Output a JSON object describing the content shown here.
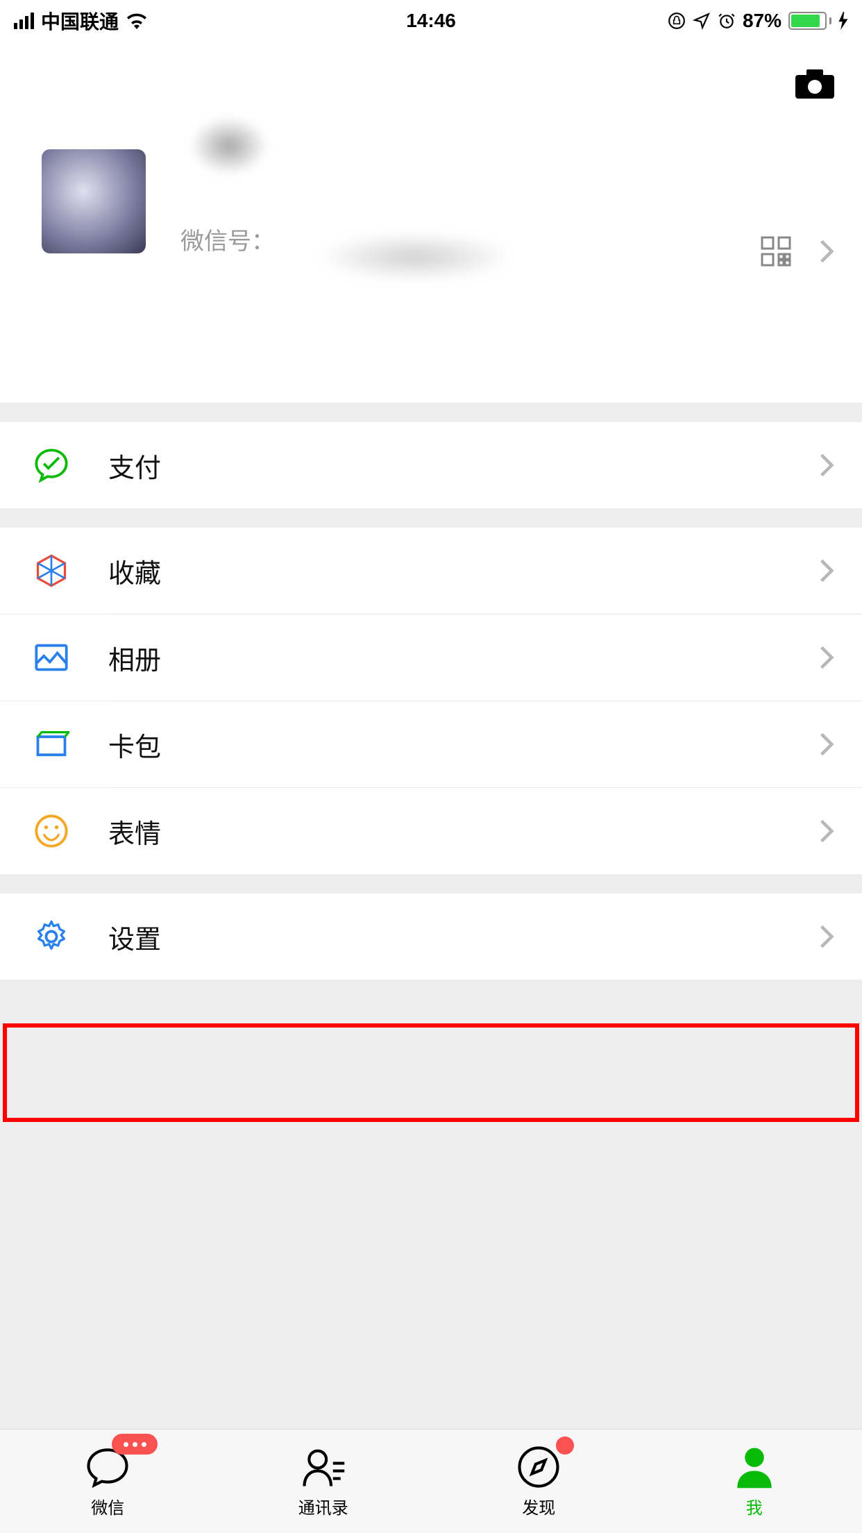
{
  "status": {
    "carrier": "中国联通",
    "time": "14:46",
    "battery_pct": "87%"
  },
  "profile": {
    "wechat_id_label": "微信号："
  },
  "menu": {
    "pay": "支付",
    "favorites": "收藏",
    "album": "相册",
    "cards": "卡包",
    "stickers": "表情",
    "settings": "设置"
  },
  "tabs": {
    "chats": "微信",
    "contacts": "通讯录",
    "discover": "发现",
    "me": "我"
  }
}
